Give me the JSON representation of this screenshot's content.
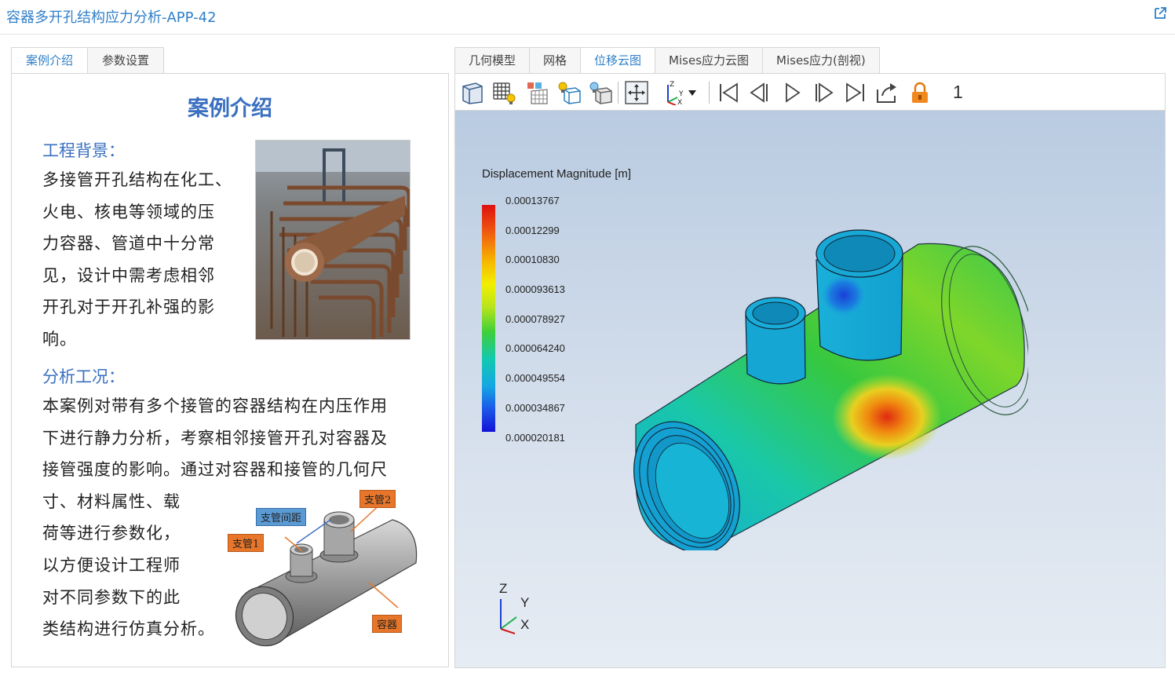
{
  "app": {
    "title": "容器多开孔结构应力分析-APP-42"
  },
  "left_tabs": [
    "案例介绍",
    "参数设置"
  ],
  "case": {
    "title": "案例介绍",
    "background_head": "工程背景：",
    "background_lines": [
      "多接管开孔结构在化工、",
      "火电、核电等领域的压",
      "力容器、管道中十分常",
      "见，设计中需考虑相邻",
      "开孔对于开孔补强的影",
      "响。"
    ],
    "analysis_head": "分析工况：",
    "analysis_lines_full": [
      "本案例对带有多个接管的容器结构在内压作用",
      "下进行静力分析，考察相邻接管开孔对容器及",
      "接管强度的影响。通过对容器和接管的几何尺"
    ],
    "analysis_lines_short": [
      "寸、材料属性、载",
      "荷等进行参数化，",
      "以方便设计工程师",
      "对不同参数下的此",
      "类结构进行仿真分析。"
    ],
    "diagram_labels": {
      "branch2": "支管2",
      "spacing": "支管间距",
      "branch1": "支管1",
      "vessel": "容器"
    }
  },
  "right_tabs": [
    "几何模型",
    "网格",
    "位移云图",
    "Mises应力云图",
    "Mises应力(剖视)"
  ],
  "toolbar": {
    "icons": [
      "solid-view-icon",
      "mesh-light-icon",
      "mesh-view-icon",
      "wireframe-light-icon",
      "surface-light-icon",
      "fit-view-icon",
      "axis-orientation-icon",
      "dropdown-arrow-icon",
      "first-frame-icon",
      "prev-frame-icon",
      "play-icon",
      "next-frame-icon",
      "last-frame-icon",
      "export-icon",
      "lock-icon"
    ],
    "frame": "1"
  },
  "legend": {
    "title": "Displacement Magnitude [m]",
    "ticks": [
      "0.00013767",
      "0.00012299",
      "0.00010830",
      "0.000093613",
      "0.000078927",
      "0.000064240",
      "0.000049554",
      "0.000034867",
      "0.000020181"
    ]
  },
  "axes": {
    "z": "Z",
    "y": "Y",
    "x": "X"
  },
  "colors": {
    "accent": "#2f7fc8",
    "heading": "#3a6fc0",
    "label_orange": "#e8762a",
    "label_blue": "#5b9bd5"
  }
}
